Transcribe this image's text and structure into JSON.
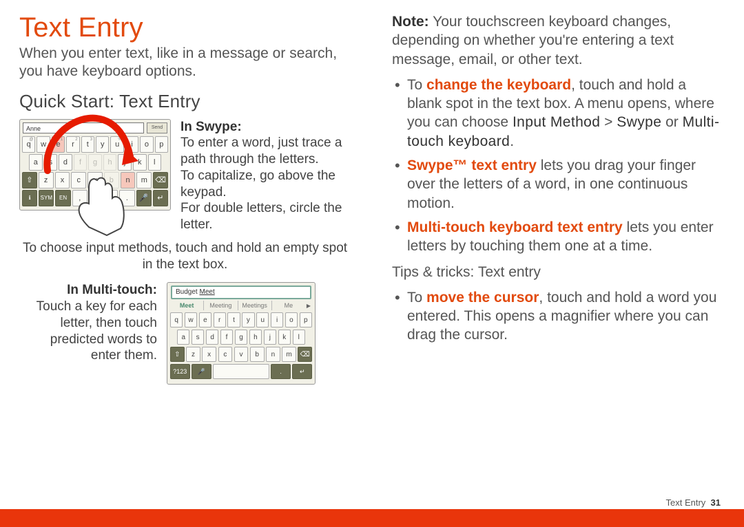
{
  "title": "Text Entry",
  "intro": "When you enter text, like in a message or search, you have keyboard options.",
  "quickstart_head": "Quick Start: Text Entry",
  "swype": {
    "label": "In Swype:",
    "l1": "To enter a word, just trace a path through the letters.",
    "l2": "To capitalize, go above the keypad.",
    "l3": "For double letters, circle the letter.",
    "input_value": "Anne",
    "send": "Send"
  },
  "mid_note": "To choose input methods, touch and hold an empty spot in the text box.",
  "multi": {
    "label": "In Multi-touch:",
    "l1": "Touch a key for each letter, then touch predicted words to enter them.",
    "input_value_a": "Budget ",
    "input_value_b": "Meet",
    "sugg": [
      "Meet",
      "Meeting",
      "Meetings",
      "Me"
    ]
  },
  "right": {
    "note_label": "Note:",
    "note_body": " Your touchscreen keyboard changes, depending on whether you're entering a text message, email, or other text.",
    "li1_a": "To ",
    "li1_bold": "change the keyboard",
    "li1_b": ", touch and hold a blank spot in the text box. A menu opens, where you can choose ",
    "li1_g1": "Input Method",
    "li1_gt": " > ",
    "li1_g2": "Swype",
    "li1_or": " or ",
    "li1_g3": "Multi-touch keyboard",
    "li1_dot": ".",
    "li2_bold": "Swype™ text entry",
    "li2_body": " lets you drag your finger over the letters of a word, in one continuous motion.",
    "li3_bold": "Multi-touch keyboard text entry",
    "li3_body": " lets you enter letters by touching them one at a time.",
    "tips_head": "Tips & tricks: Text entry",
    "tip1_a": "To ",
    "tip1_bold": "move the cursor",
    "tip1_b": ", touch and hold a word you entered. This opens a magnifier where you can drag the cursor."
  },
  "footer": {
    "section": "Text Entry",
    "page": "31"
  },
  "keys": {
    "row1": [
      "q",
      "w",
      "e",
      "r",
      "t",
      "y",
      "u",
      "i",
      "o",
      "p"
    ],
    "sups": [
      "@",
      "1",
      "2",
      "3",
      "%"
    ],
    "row2": [
      "a",
      "s",
      "d",
      "f",
      "g",
      "h",
      "j",
      "k",
      "l"
    ],
    "row3": [
      "z",
      "x",
      "c",
      "v",
      "b",
      "n",
      "m"
    ],
    "sym": "SYM",
    "en": "EN",
    "q123": "?123"
  }
}
